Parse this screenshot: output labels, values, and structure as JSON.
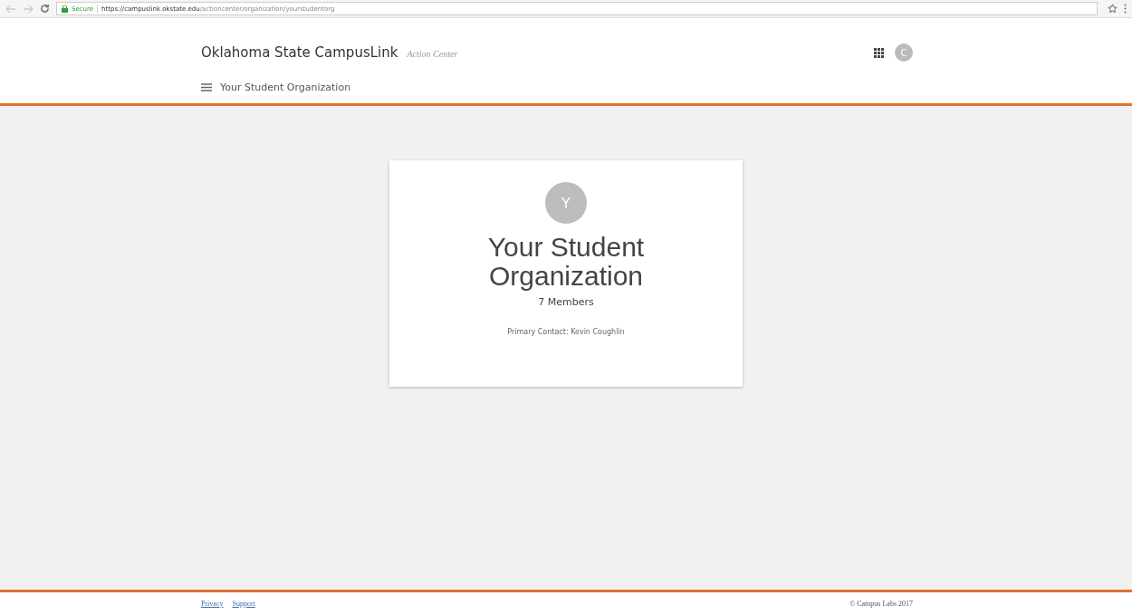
{
  "browser": {
    "secure_label": "Secure",
    "url_host": "https://campuslink.okstate.edu",
    "url_path": "/actioncenter/organization/yourstudentorg"
  },
  "header": {
    "site_title": "Oklahoma State CampusLink",
    "section": "Action Center",
    "avatar_letter": "C",
    "nav_title": "Your Student Organization"
  },
  "card": {
    "avatar_letter": "Y",
    "name": "Your Student Organization",
    "members": "7 Members",
    "contact": "Primary Contact: Kevin Coughlin"
  },
  "footer": {
    "links": [
      "Privacy",
      "Support"
    ],
    "copyright": "© Campus Labs 2017"
  }
}
